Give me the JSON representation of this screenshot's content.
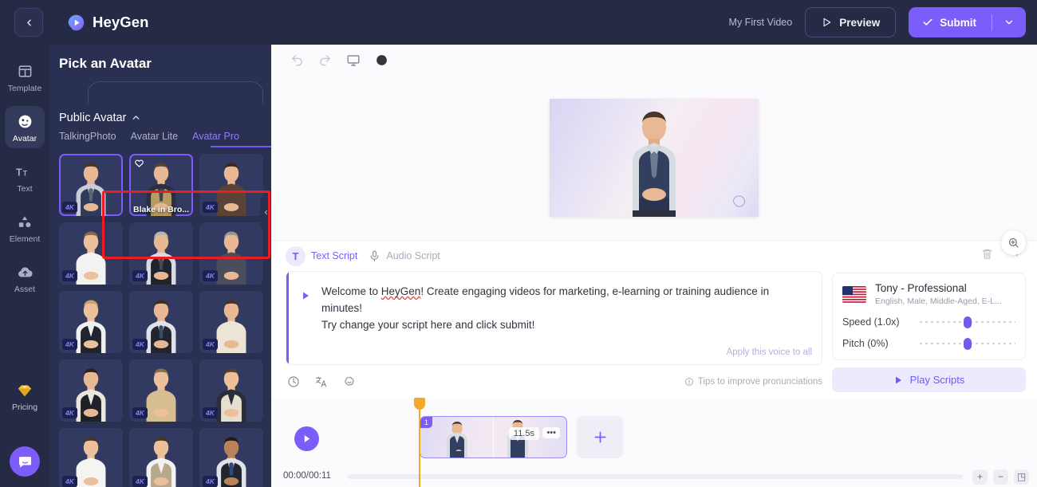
{
  "header": {
    "back_icon": "chevron-left-icon",
    "brand": "HeyGen",
    "video_title": "My First Video",
    "preview_label": "Preview",
    "submit_label": "Submit",
    "accent": "#7c5cfa"
  },
  "rail": {
    "items": [
      {
        "label": "Template",
        "icon": "template-icon",
        "active": false
      },
      {
        "label": "Avatar",
        "icon": "avatar-icon",
        "active": true
      },
      {
        "label": "Text",
        "icon": "text-icon",
        "active": false
      },
      {
        "label": "Element",
        "icon": "element-icon",
        "active": false
      },
      {
        "label": "Asset",
        "icon": "asset-cloud-icon",
        "active": false
      }
    ],
    "pricing": {
      "label": "Pricing",
      "icon": "diamond-icon"
    },
    "chat_icon": "chat-bubble-icon"
  },
  "panel": {
    "title": "Pick an Avatar",
    "search_placeholder": "",
    "section": "Public Avatar",
    "tabs": [
      {
        "label": "TalkingPhoto",
        "active": false
      },
      {
        "label": "Avatar Lite",
        "active": false
      },
      {
        "label": "Avatar Pro",
        "active": true
      }
    ],
    "badge_4k": "4K",
    "avatars": [
      {
        "name": "",
        "badge": "4K",
        "selected": true,
        "fav": false,
        "skin": "#e8b894",
        "hair": "#4a3322",
        "top": "#303a5c",
        "shirt": "#c8cdd8",
        "tie": "#5a6478",
        "style": "vest"
      },
      {
        "name": "Blake in Bro...",
        "badge": "",
        "selected": true,
        "fav": true,
        "skin": "#e8b894",
        "hair": "#5a4330",
        "top": "#b99a63",
        "shirt": "#2a3040",
        "tie": "#3c4558",
        "style": "coat"
      },
      {
        "name": "",
        "badge": "4K",
        "selected": false,
        "fav": false,
        "skin": "#e8b894",
        "hair": "#3a2a1c",
        "top": "#5a4336",
        "shirt": "#5a4336",
        "tie": "",
        "style": "sweater"
      },
      {
        "name": "",
        "badge": "4K",
        "selected": false,
        "fav": false,
        "skin": "#edc09c",
        "hair": "#8a6a44",
        "top": "#f2f2f0",
        "shirt": "#f2f2f0",
        "tie": "",
        "style": "tee"
      },
      {
        "name": "",
        "badge": "4K",
        "selected": false,
        "fav": false,
        "skin": "#e8b894",
        "hair": "#b9b5ad",
        "top": "#21242c",
        "shirt": "#d8dbe2",
        "tie": "#444a58",
        "style": "suit"
      },
      {
        "name": "",
        "badge": "4K",
        "selected": false,
        "fav": false,
        "skin": "#e8b894",
        "hair": "#9a9691",
        "top": "#4a4e5c",
        "shirt": "#4a4e5c",
        "tie": "",
        "style": "shirt"
      },
      {
        "name": "",
        "badge": "4K",
        "selected": false,
        "fav": false,
        "skin": "#edc09c",
        "hair": "#c9a464",
        "top": "#21242c",
        "shirt": "#f0f0ee",
        "tie": "",
        "style": "blazer"
      },
      {
        "name": "",
        "badge": "4K",
        "selected": false,
        "fav": false,
        "skin": "#e8b894",
        "hair": "#3f2d1e",
        "top": "#22252e",
        "shirt": "#dfe2e8",
        "tie": "#3a4a6a",
        "style": "suit"
      },
      {
        "name": "",
        "badge": "4K",
        "selected": false,
        "fav": false,
        "skin": "#e8b894",
        "hair": "#4a3322",
        "top": "#ece5d6",
        "shirt": "#ece5d6",
        "tie": "",
        "style": "jacket"
      },
      {
        "name": "",
        "badge": "4K",
        "selected": false,
        "fav": false,
        "skin": "#e8b894",
        "hair": "#2e2218",
        "top": "#1e2128",
        "shirt": "#e9e6de",
        "tie": "",
        "style": "varsity"
      },
      {
        "name": "",
        "badge": "4K",
        "selected": false,
        "fav": false,
        "skin": "#edc09c",
        "hair": "#8a7048",
        "top": "#d6bd92",
        "shirt": "#d6bd92",
        "tie": "",
        "style": "sweater"
      },
      {
        "name": "",
        "badge": "4K",
        "selected": false,
        "fav": false,
        "skin": "#edc09c",
        "hair": "#5b4128",
        "top": "#e6ded0",
        "shirt": "#2a2e38",
        "tie": "",
        "style": "blazer"
      },
      {
        "name": "",
        "badge": "4K",
        "selected": false,
        "fav": false,
        "skin": "#edc09c",
        "hair": "#4a3524",
        "top": "#f4f4f2",
        "shirt": "#f4f4f2",
        "tie": "",
        "style": "tee"
      },
      {
        "name": "",
        "badge": "4K",
        "selected": false,
        "fav": false,
        "skin": "#edc09c",
        "hair": "#4a3524",
        "top": "#b9a98c",
        "shirt": "#f2f2f0",
        "tie": "",
        "style": "tweed"
      },
      {
        "name": "",
        "badge": "4K",
        "selected": false,
        "fav": false,
        "skin": "#b98258",
        "hair": "#241a12",
        "top": "#22252e",
        "shirt": "#dfe2e8",
        "tie": "#2f4a7a",
        "style": "suit"
      }
    ],
    "collapse_icon": "chevron-left-icon"
  },
  "canvas": {
    "toolbar": [
      {
        "icon": "undo-icon",
        "enabled": false
      },
      {
        "icon": "redo-icon",
        "enabled": false
      },
      {
        "icon": "monitor-icon",
        "enabled": true
      },
      {
        "icon": "circle-filled-icon",
        "enabled": true
      }
    ],
    "zoom_icon": "zoom-in-icon",
    "watermark": "heygen-watermark"
  },
  "script": {
    "tabs": [
      {
        "label": "Text Script",
        "icon": "text-script-icon",
        "active": true
      },
      {
        "label": "Audio Script",
        "icon": "microphone-icon",
        "active": false
      }
    ],
    "delete_icon": "trash-icon",
    "collapse_icon": "chevron-down-icon",
    "play_icon": "play-triangle-icon",
    "line1_a": "Welcome to ",
    "line1_spell": "HeyGen",
    "line1_b": "! Create engaging videos for marketing, e-learning or training audience in minutes!",
    "line2": "Try change your script here and click submit!",
    "apply_all": "Apply this voice to all",
    "footer_icons": [
      {
        "icon": "clock-icon"
      },
      {
        "icon": "translate-icon"
      },
      {
        "icon": "ai-sparkle-icon"
      }
    ],
    "tips": "Tips to improve pronunciations",
    "tips_icon": "info-icon"
  },
  "voice": {
    "flag": "us-flag-icon",
    "name": "Tony - Professional",
    "meta": "English, Male, Middle-Aged, E-L...",
    "speed_label": "Speed (1.0x)",
    "speed_value": 50,
    "pitch_label": "Pitch (0%)",
    "pitch_value": 50,
    "play_label": "Play Scripts",
    "play_icon": "play-triangle-icon"
  },
  "timeline": {
    "play_icon": "play-icon",
    "time": "00:00/00:11",
    "clips": [
      {
        "number": "1",
        "duration": "11.5s",
        "more": "•••"
      }
    ],
    "add_icon": "plus-icon",
    "buttons": [
      {
        "icon": "zoom-in-icon",
        "glyph": "+"
      },
      {
        "icon": "zoom-out-icon",
        "glyph": "−"
      },
      {
        "icon": "fit-icon",
        "glyph": "◳"
      }
    ]
  }
}
